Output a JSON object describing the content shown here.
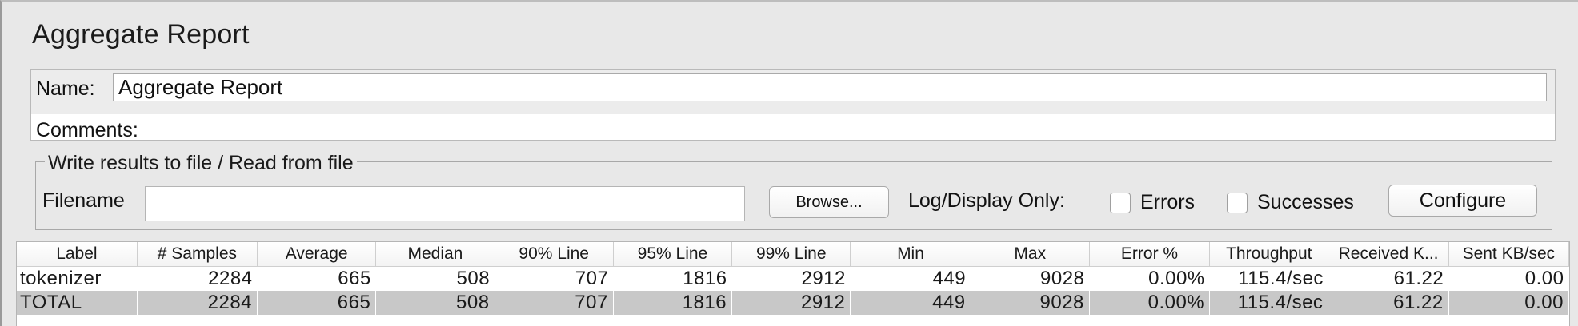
{
  "panel": {
    "title": "Aggregate Report"
  },
  "fields": {
    "name_label": "Name:",
    "name_value": "Aggregate Report",
    "comments_label": "Comments:"
  },
  "file_section": {
    "legend": "Write results to file / Read from file",
    "filename_label": "Filename",
    "filename_value": "",
    "browse_label": "Browse...",
    "log_display_label": "Log/Display Only:",
    "errors_label": "Errors",
    "successes_label": "Successes",
    "configure_label": "Configure"
  },
  "table": {
    "columns": [
      "Label",
      "# Samples",
      "Average",
      "Median",
      "90% Line",
      "95% Line",
      "99% Line",
      "Min",
      "Max",
      "Error %",
      "Throughput",
      "Received K...",
      "Sent KB/sec"
    ],
    "rows": [
      [
        "tokenizer",
        "2284",
        "665",
        "508",
        "707",
        "1816",
        "2912",
        "449",
        "9028",
        "0.00%",
        "115.4/sec",
        "61.22",
        "0.00"
      ],
      [
        "TOTAL",
        "2284",
        "665",
        "508",
        "707",
        "1816",
        "2912",
        "449",
        "9028",
        "0.00%",
        "115.4/sec",
        "61.22",
        "0.00"
      ]
    ]
  }
}
